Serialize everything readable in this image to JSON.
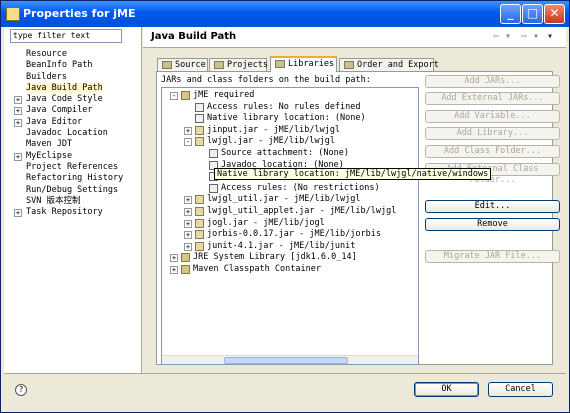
{
  "window": {
    "title": "Properties for jME",
    "minimize": "_",
    "maximize": "□",
    "close": "✕"
  },
  "filter": {
    "value": "type filter text"
  },
  "nav": [
    {
      "label": "Resource",
      "expandable": false
    },
    {
      "label": "BeanInfo Path",
      "expandable": false
    },
    {
      "label": "Builders",
      "expandable": false
    },
    {
      "label": "Java Build Path",
      "expandable": false,
      "selected": true
    },
    {
      "label": "Java Code Style",
      "expandable": true
    },
    {
      "label": "Java Compiler",
      "expandable": true
    },
    {
      "label": "Java Editor",
      "expandable": true
    },
    {
      "label": "Javadoc Location",
      "expandable": false
    },
    {
      "label": "Maven JDT",
      "expandable": false
    },
    {
      "label": "MyEclipse",
      "expandable": true
    },
    {
      "label": "Project References",
      "expandable": false
    },
    {
      "label": "Refactoring History",
      "expandable": false
    },
    {
      "label": "Run/Debug Settings",
      "expandable": false
    },
    {
      "label": "SVN 版本控制",
      "expandable": false
    },
    {
      "label": "Task Repository",
      "expandable": true
    }
  ],
  "header": {
    "title": "Java Build Path",
    "back": "⇦ ▾",
    "forward": "⇨ ▾",
    "menu": "▾"
  },
  "tabs": [
    {
      "label": "Source"
    },
    {
      "label": "Projects"
    },
    {
      "label": "Libraries",
      "active": true
    },
    {
      "label": "Order and Export"
    }
  ],
  "panel_title": "JARs and class folders on the build path:",
  "tree": [
    {
      "text": "jME required",
      "indent": 0,
      "exp": "-",
      "icon": "lib"
    },
    {
      "text": "Access rules: No rules defined",
      "indent": 1,
      "exp": "",
      "icon": "att"
    },
    {
      "text": "Native library location: (None)",
      "indent": 1,
      "exp": "",
      "icon": "att"
    },
    {
      "text": "jinput.jar - jME/lib/lwjgl",
      "indent": 1,
      "exp": "+",
      "icon": "jar"
    },
    {
      "text": "lwjgl.jar - jME/lib/lwjgl",
      "indent": 1,
      "exp": "-",
      "icon": "jar"
    },
    {
      "text": "Source attachment: (None)",
      "indent": 2,
      "exp": "",
      "icon": "att"
    },
    {
      "text": "Javadoc location: (None)",
      "indent": 2,
      "exp": "",
      "icon": "att"
    },
    {
      "text": "Native library location: jME/lib/lwjgl/native/windows",
      "indent": 2,
      "exp": "",
      "icon": "att"
    },
    {
      "text": "Access rules: (No restrictions)",
      "indent": 2,
      "exp": "",
      "icon": "att"
    },
    {
      "text": "lwjgl_util.jar - jME/lib/lwjgl",
      "indent": 1,
      "exp": "+",
      "icon": "jar"
    },
    {
      "text": "lwjgl_util_applet.jar - jME/lib/lwjgl",
      "indent": 1,
      "exp": "+",
      "icon": "jar"
    },
    {
      "text": "jogl.jar - jME/lib/jogl",
      "indent": 1,
      "exp": "+",
      "icon": "jar"
    },
    {
      "text": "jorbis-0.0.17.jar - jME/lib/jorbis",
      "indent": 1,
      "exp": "+",
      "icon": "jar"
    },
    {
      "text": "junit-4.1.jar - jME/lib/junit",
      "indent": 1,
      "exp": "+",
      "icon": "jar"
    },
    {
      "text": "JRE System Library [jdk1.6.0_14]",
      "indent": 0,
      "exp": "+",
      "icon": "lib"
    },
    {
      "text": "Maven Classpath Container",
      "indent": 0,
      "exp": "+",
      "icon": "lib"
    }
  ],
  "tooltip": "Native library location: jME/lib/lwjgl/native/windows",
  "buttons": [
    {
      "label": "Add JARs...",
      "enabled": false
    },
    {
      "label": "Add External JARs...",
      "enabled": false
    },
    {
      "label": "Add Variable...",
      "enabled": false
    },
    {
      "label": "Add Library...",
      "enabled": false
    },
    {
      "label": "Add Class Folder...",
      "enabled": false
    },
    {
      "label": "Add External Class Folder...",
      "enabled": false
    },
    {
      "label": "Edit...",
      "enabled": true
    },
    {
      "label": "Remove",
      "enabled": true
    },
    {
      "label": "Migrate JAR File...",
      "enabled": false
    }
  ],
  "footer": {
    "help": "?",
    "ok": "OK",
    "cancel": "Cancel"
  },
  "colors": {
    "titlebar": "#0058ee",
    "dialog": "#ece9d8",
    "tab_accent": "#f8a838",
    "tooltip": "#ffffe1"
  }
}
